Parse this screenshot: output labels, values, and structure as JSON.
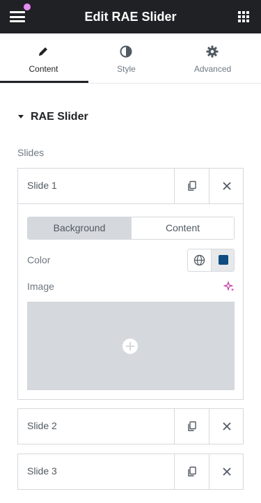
{
  "colors": {
    "header_bg": "#1f2124",
    "notification_dot": "#e78cf2",
    "selected_color": "#0f4c81",
    "ai_accent": "#c13aa4"
  },
  "header": {
    "title": "Edit RAE Slider",
    "menu_icon": "hamburger-icon",
    "widgets_icon": "grid-icon"
  },
  "tabs": [
    {
      "label": "Content",
      "icon": "pencil-icon",
      "active": true
    },
    {
      "label": "Style",
      "icon": "half-circle-icon",
      "active": false
    },
    {
      "label": "Advanced",
      "icon": "gear-icon",
      "active": false
    }
  ],
  "section": {
    "title": "RAE Slider",
    "slides_label": "Slides"
  },
  "slides": [
    {
      "title": "Slide 1",
      "expanded": true
    },
    {
      "title": "Slide 2",
      "expanded": false
    },
    {
      "title": "Slide 3",
      "expanded": false
    }
  ],
  "slide_editor": {
    "switcher": [
      "Background",
      "Content"
    ],
    "active_switch": "Background",
    "color_label": "Color",
    "image_label": "Image"
  }
}
